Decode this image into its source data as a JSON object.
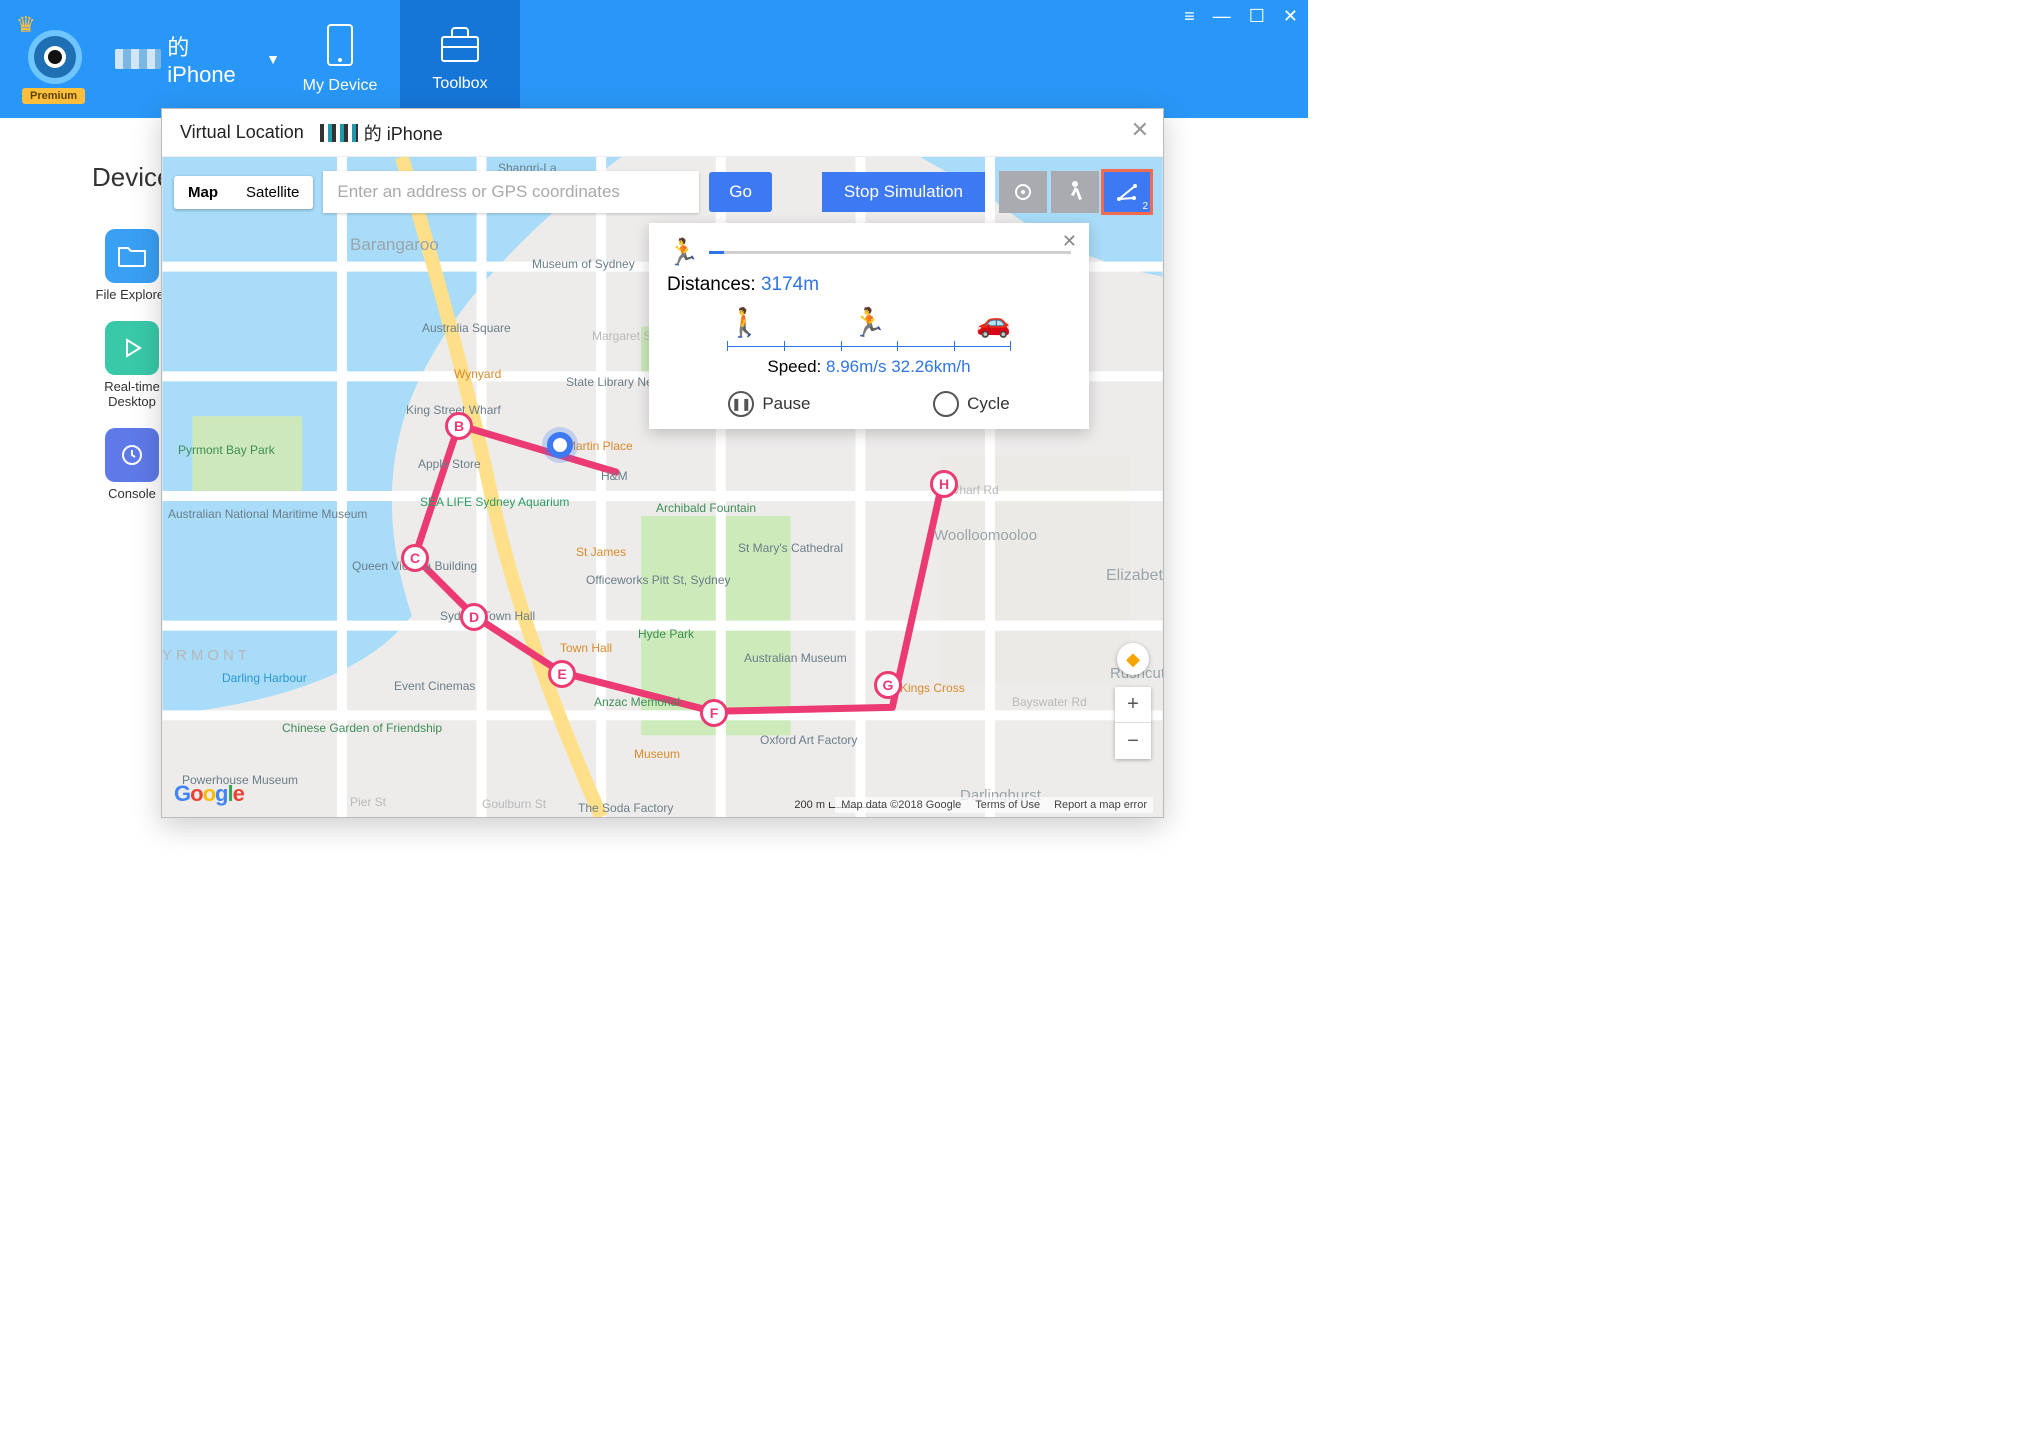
{
  "header": {
    "device_name_suffix": "的 iPhone",
    "premium": "Premium",
    "tabs": {
      "my_device": "My Device",
      "toolbox": "Toolbox"
    }
  },
  "sidebar": {
    "heading": "Device",
    "items": [
      {
        "label": "File Explorer",
        "color": "#39a0f4"
      },
      {
        "label": "Real-time Desktop",
        "color": "#39c9a9"
      },
      {
        "label": "Console",
        "color": "#5d7ae8"
      }
    ]
  },
  "modal": {
    "title_prefix": "Virtual Location",
    "title_suffix": "的 iPhone"
  },
  "map": {
    "type_map": "Map",
    "type_sat": "Satellite",
    "search_placeholder": "Enter an address or GPS coordinates",
    "go": "Go",
    "stop": "Stop Simulation",
    "route_badge": "2",
    "pins": [
      "B",
      "C",
      "D",
      "E",
      "F",
      "G",
      "H"
    ],
    "attribution": "Map data ©2018 Google",
    "scale": "200 m",
    "terms": "Terms of Use",
    "report": "Report a map error",
    "labels": {
      "barangaroo": "Barangaroo",
      "pyrmont_bay": "Pyrmont Bay Park",
      "maritime": "Australian National Maritime Museum",
      "darling": "Darling Harbour",
      "chinese": "Chinese Garden of Friendship",
      "powerhouse": "Powerhouse Museum",
      "australia_sq": "Australia Square",
      "wynyard": "Wynyard",
      "king_st": "King Street Wharf",
      "sealife": "SEA LIFE Sydney Aquarium",
      "qvb": "Queen Victoria Building",
      "townhall": "Town Hall",
      "event": "Event Cinemas",
      "anzac": "Anzac Memorial",
      "museum": "Museum",
      "oxford": "Oxford Art Factory",
      "aus_museum": "Australian Museum",
      "hydepark": "Hyde Park",
      "stmary": "St Mary's Cathedral",
      "stjames": "St James",
      "archibald": "Archibald Fountain",
      "woolloo": "Woolloomooloo",
      "kingscross": "Kings Cross",
      "eliza": "Elizabeth Bay",
      "darlinghurst": "Darlinghurst",
      "sydney_museum": "Museum of Sydney",
      "martin": "Martin Place",
      "hm": "H&M",
      "apple": "Apple Store",
      "officeworks": "Officeworks Pitt St, Sydney",
      "soda": "The Soda Factory",
      "yrmont": "YRMONT",
      "rushcutters": "Rushcutters Bay",
      "shangrila": "Shangri-La",
      "state_library": "State Library New South Wales",
      "town_hall_icon": "Sydney Town Hall",
      "goulburn": "Goulburn St",
      "pier": "Pier St",
      "margaret": "Margaret St",
      "wharf": "Wharf Rd",
      "bayswater": "Bayswater Rd"
    }
  },
  "info": {
    "distances_label": "Distances:",
    "distances_value": "3174m",
    "speed_label": "Speed:",
    "speed_value": "8.96m/s 32.26km/h",
    "pause": "Pause",
    "cycle": "Cycle"
  }
}
